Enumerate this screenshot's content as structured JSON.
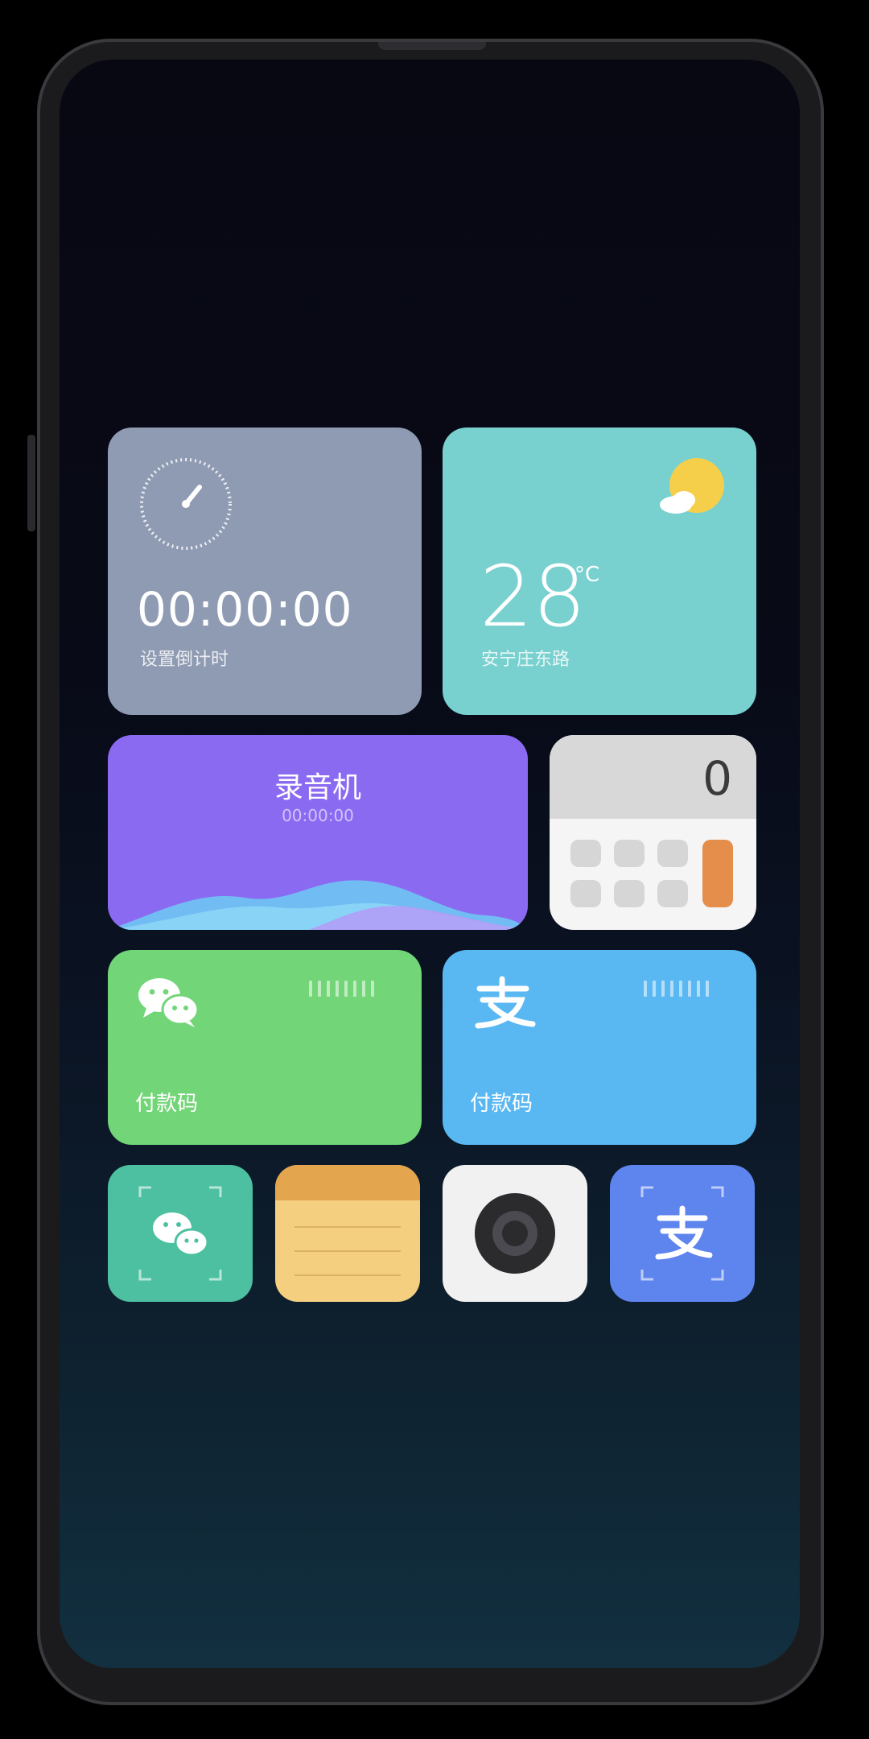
{
  "timer_widget": {
    "time": "00:00:00",
    "label": "设置倒计时",
    "icon": "timer-dial-icon"
  },
  "weather_widget": {
    "temperature": "28",
    "unit": "°C",
    "location": "安宁庄东路",
    "icon": "sun-cloud-icon"
  },
  "recorder_widget": {
    "title": "录音机",
    "time": "00:00:00"
  },
  "calculator_widget": {
    "display": "0"
  },
  "wechat_pay_widget": {
    "label": "付款码",
    "icon": "wechat-icon",
    "color": "#72d577"
  },
  "alipay_widget": {
    "label": "付款码",
    "icon": "alipay-icon",
    "color": "#59b7f2"
  },
  "shortcuts": [
    {
      "name": "wechat-scan",
      "icon": "wechat-scan-icon"
    },
    {
      "name": "notes",
      "icon": "notes-icon"
    },
    {
      "name": "camera",
      "icon": "camera-icon"
    },
    {
      "name": "alipay-scan",
      "icon": "alipay-scan-icon"
    }
  ]
}
